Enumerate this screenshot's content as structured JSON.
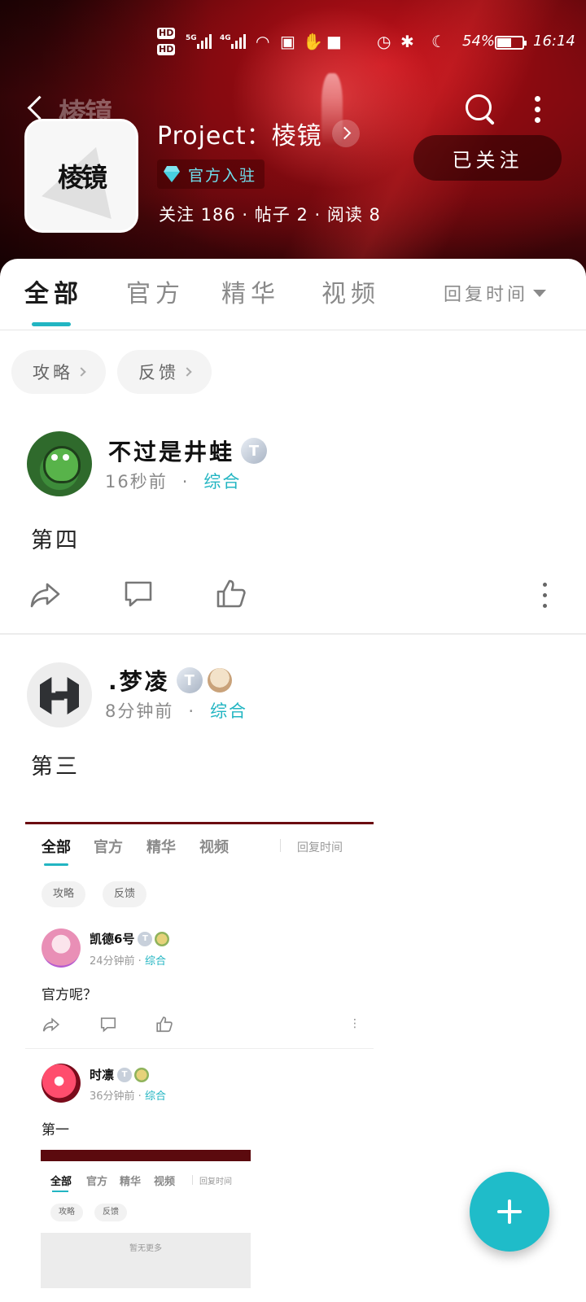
{
  "status_bar": {
    "hd1": "HD",
    "hd2": "HD",
    "net1": "5G",
    "net2": "4G",
    "battery_percent": "54%",
    "battery_level": 0.54,
    "time": "16:14"
  },
  "header": {
    "title": "Project：棱镜",
    "official_label": "官方入驻",
    "stats": "关注 186 · 帖子 2 · 阅读 8",
    "follow_label": "已关注",
    "logo_text": "棱镜"
  },
  "tabs": {
    "items": [
      {
        "label": "全部",
        "active": true
      },
      {
        "label": "官方",
        "active": false
      },
      {
        "label": "精华",
        "active": false
      },
      {
        "label": "视频",
        "active": false
      }
    ],
    "sort_label": "回复时间"
  },
  "chips": [
    {
      "label": "攻略"
    },
    {
      "label": "反馈"
    }
  ],
  "posts": [
    {
      "author": "不过是井蛙",
      "badge": "T",
      "time": "16秒前",
      "dot": "·",
      "topic": "综合",
      "content": "第四"
    },
    {
      "author": ".梦凌",
      "badge": "T",
      "time": "8分钟前",
      "dot": "·",
      "topic": "综合",
      "content": "第三"
    }
  ],
  "embedded_screenshot": {
    "tabs": [
      "全部",
      "官方",
      "精华",
      "视频"
    ],
    "sort_label": "回复时间",
    "chips": [
      "攻略",
      "反馈"
    ],
    "posts": [
      {
        "author": "凯德6号",
        "badge": "T",
        "time": "24分钟前",
        "topic": "综合",
        "content": "官方呢？"
      },
      {
        "author": "时凛",
        "badge": "T",
        "time": "36分钟前",
        "topic": "综合",
        "content": "第一"
      }
    ],
    "inner": {
      "tabs": [
        "全部",
        "官方",
        "精华",
        "视频"
      ],
      "sort_label": "回复时间",
      "chips": [
        "攻略",
        "反馈"
      ],
      "empty_text": "暂无更多"
    }
  },
  "colors": {
    "accent": "#22b5c2",
    "fab": "#1fbcc9",
    "header_red": "#c5121b"
  },
  "icons": {
    "back": "back-arrow-icon",
    "search": "search-icon",
    "more": "more-vertical-icon",
    "share": "share-icon",
    "comment": "comment-icon",
    "like": "thumbs-up-icon",
    "fab": "plus-icon"
  }
}
